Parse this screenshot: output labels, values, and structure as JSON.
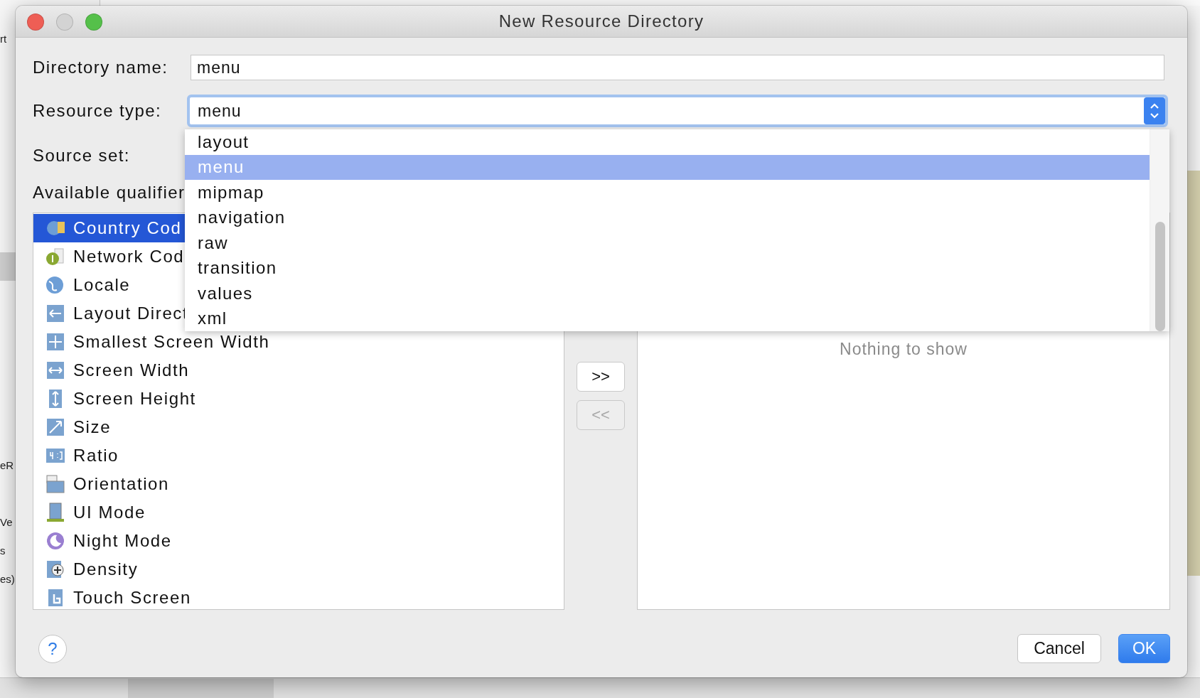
{
  "background_window": {
    "text_fragments": [
      "rt",
      "eR",
      "Ve",
      "s",
      "es)"
    ]
  },
  "window": {
    "title": "New Resource Directory"
  },
  "directory_name": {
    "label": "Directory name:",
    "value": "menu"
  },
  "resource_type": {
    "label": "Resource type:",
    "value": "menu",
    "options": [
      {
        "label": "layout",
        "selected": false
      },
      {
        "label": "menu",
        "selected": true
      },
      {
        "label": "mipmap",
        "selected": false
      },
      {
        "label": "navigation",
        "selected": false
      },
      {
        "label": "raw",
        "selected": false
      },
      {
        "label": "transition",
        "selected": false
      },
      {
        "label": "values",
        "selected": false
      },
      {
        "label": "xml",
        "selected": false
      }
    ]
  },
  "source_set": {
    "label": "Source set:"
  },
  "available_qualifiers": {
    "label": "Available qualifier",
    "items": [
      {
        "label": "Country Cod",
        "selected": true
      },
      {
        "label": "Network Cod",
        "selected": false
      },
      {
        "label": "Locale",
        "selected": false
      },
      {
        "label": "Layout Direct",
        "selected": false
      },
      {
        "label": "Smallest Screen Width",
        "selected": false
      },
      {
        "label": "Screen Width",
        "selected": false
      },
      {
        "label": "Screen Height",
        "selected": false
      },
      {
        "label": "Size",
        "selected": false
      },
      {
        "label": "Ratio",
        "selected": false
      },
      {
        "label": "Orientation",
        "selected": false
      },
      {
        "label": "UI Mode",
        "selected": false
      },
      {
        "label": "Night Mode",
        "selected": false
      },
      {
        "label": "Density",
        "selected": false
      },
      {
        "label": "Touch Screen",
        "selected": false
      }
    ]
  },
  "transfer_buttons": [
    {
      "label": ">>",
      "disabled": false
    },
    {
      "label": "<<",
      "disabled": true
    }
  ],
  "chosen_qualifiers": {
    "empty_text": "Nothing to show"
  },
  "help_button": {
    "label": "?"
  },
  "buttons": [
    {
      "label": "Cancel",
      "kind": "secondary"
    },
    {
      "label": "OK",
      "kind": "primary"
    }
  ]
}
